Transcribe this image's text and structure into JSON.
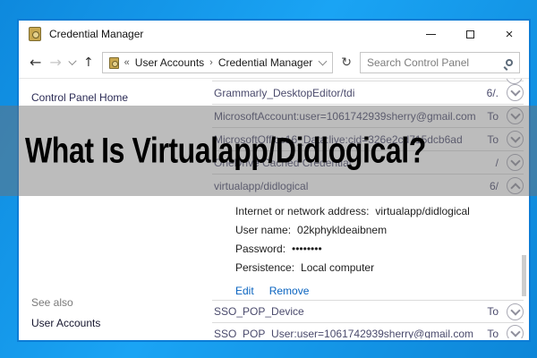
{
  "overlay": {
    "title": "What Is Virtualapp/Didlogical?"
  },
  "window": {
    "title": "Credential Manager"
  },
  "icons": {
    "back": "←",
    "forward": "→",
    "up": "↑",
    "refresh": "↻",
    "close": "×"
  },
  "toolbar": {
    "breadcrumb": {
      "prefix": "«",
      "separator": "›",
      "items": [
        "User Accounts",
        "Credential Manager"
      ]
    },
    "search": {
      "placeholder": "Search Control Panel"
    }
  },
  "sidebar": {
    "home": "Control Panel Home",
    "see_also": "See also",
    "user_accounts": "User Accounts"
  },
  "credentials": {
    "rows": [
      {
        "name": "Grammarly_DesktopEditor/tdi",
        "modified": "6/."
      },
      {
        "name": "MicrosoftAccount:user=1061742939sherry@gmail.com",
        "modified": "To"
      },
      {
        "name": "MicrosoftOffice16_Data:live:cid=326e2cd715dcb6ad",
        "modified": "To"
      },
      {
        "name": "OneDrive Cached Credential",
        "modified": "/"
      },
      {
        "name": "virtualapp/didlogical",
        "modified": "6/"
      },
      {
        "name": "SSO_POP_Device",
        "modified": "To"
      },
      {
        "name": "SSO_POP_User:user=1061742939sherry@gmail.com",
        "modified": "To"
      }
    ],
    "details": {
      "address_label": "Internet or network address:",
      "address_value": "virtualapp/didlogical",
      "username_label": "User name:",
      "username_value": "02kphykldeaibnem",
      "password_label": "Password:",
      "password_value": "••••••••",
      "persistence_label": "Persistence:",
      "persistence_value": "Local computer",
      "edit": "Edit",
      "remove": "Remove"
    }
  },
  "colors": {
    "desktop_blue": "#149ae8",
    "window_accent_border": "#0c7cd5",
    "overlay_gray": "rgba(112,112,112,0.47)",
    "link_blue": "#0a64c0"
  }
}
